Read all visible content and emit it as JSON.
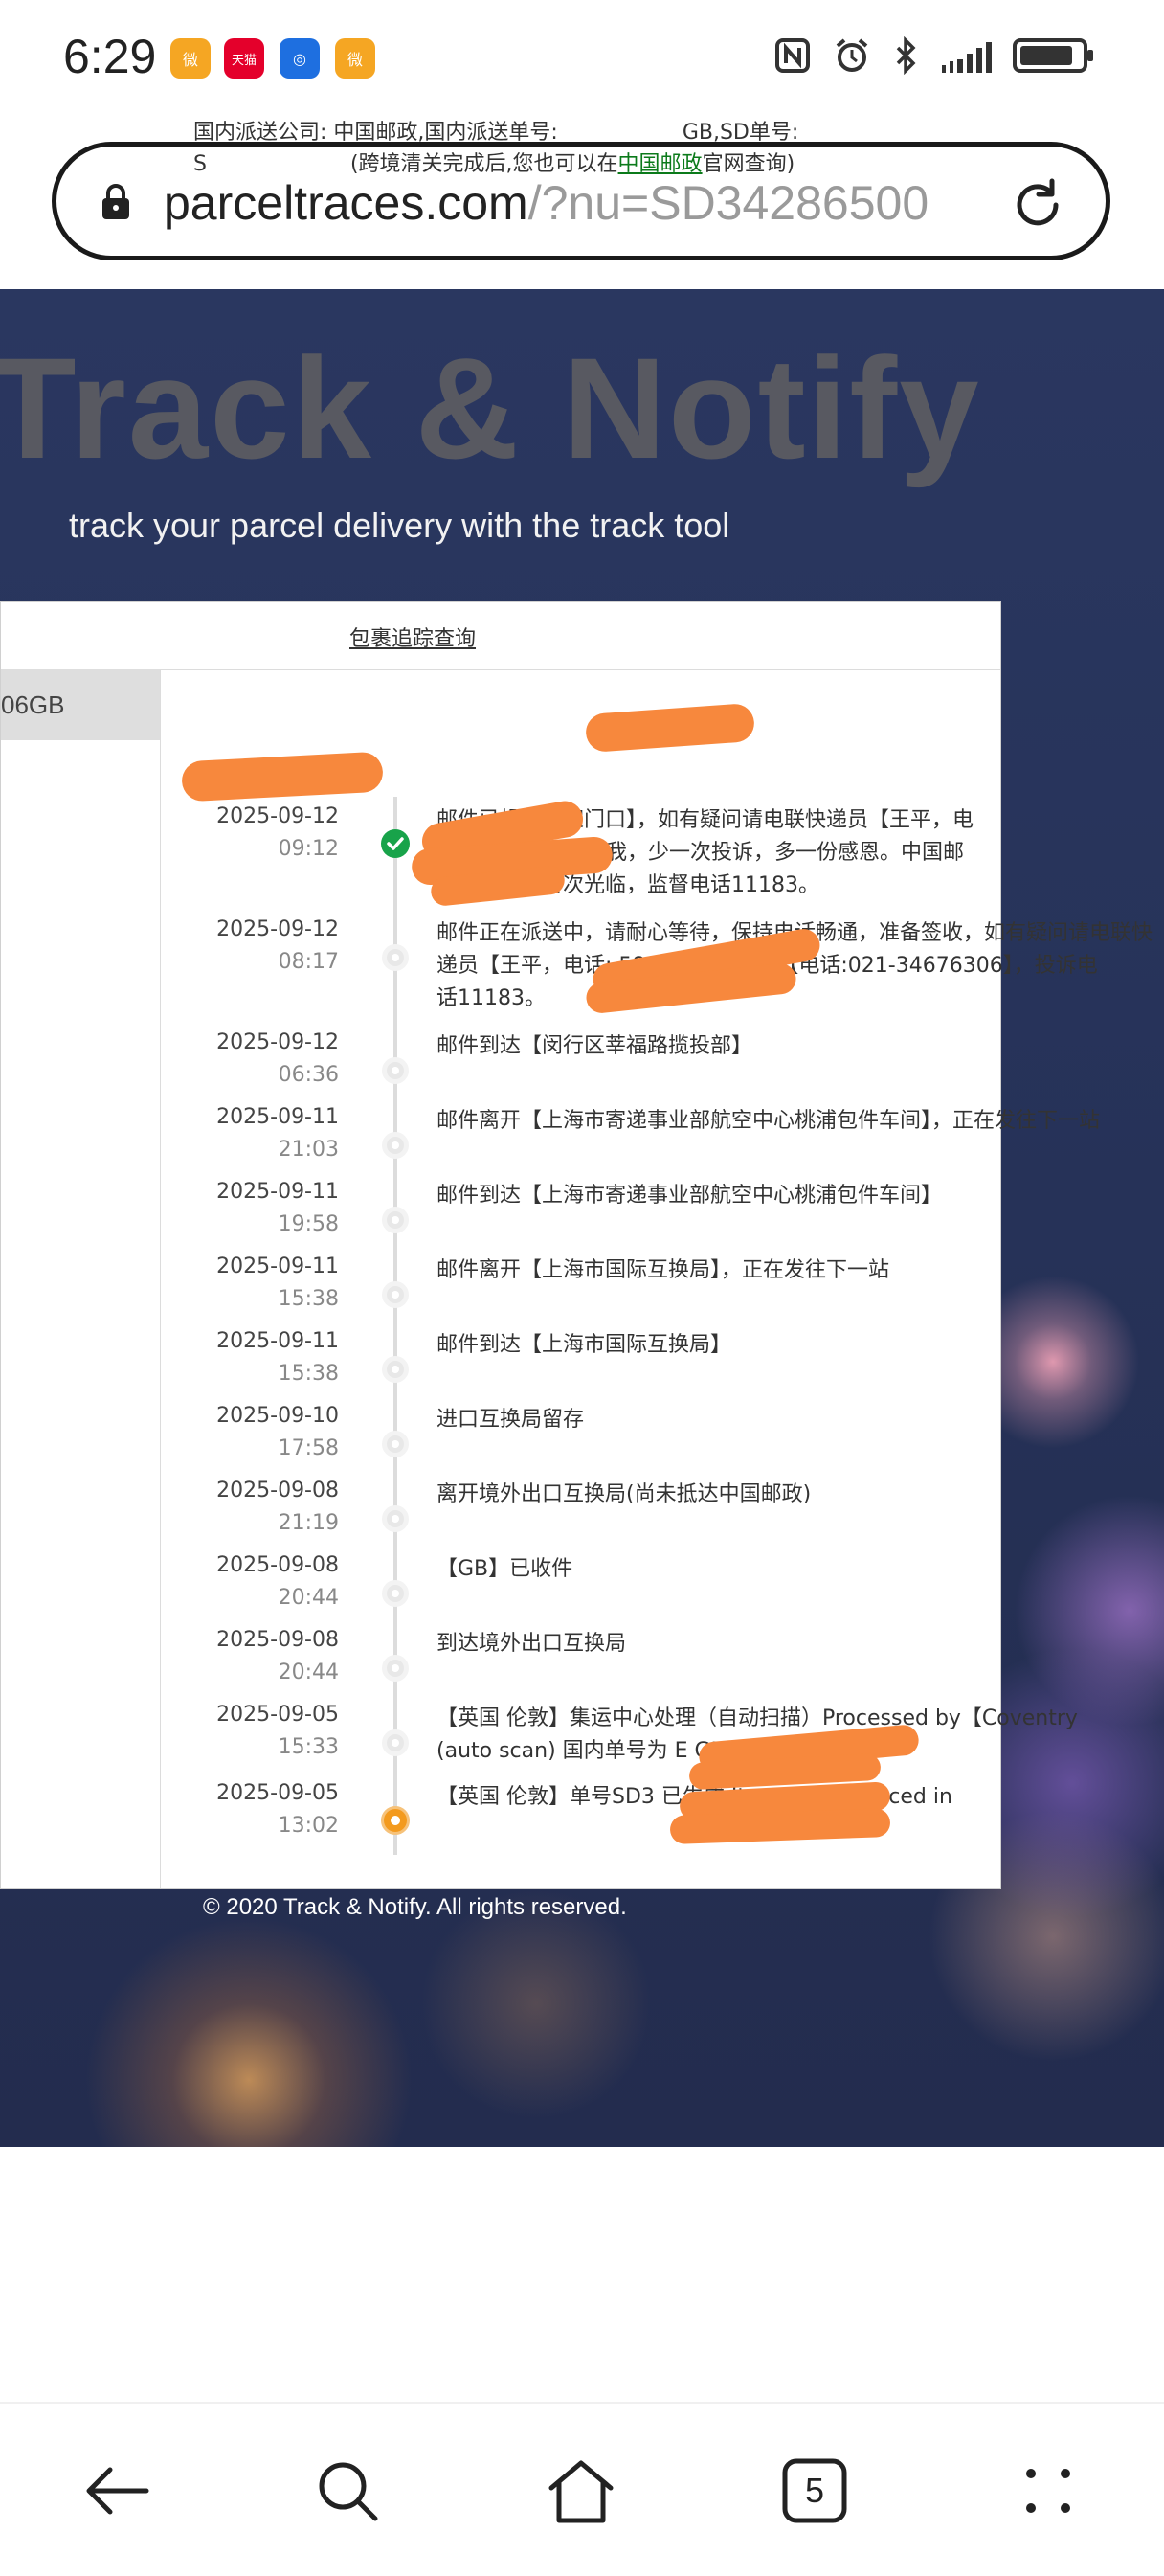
{
  "status_bar": {
    "time": "6:29",
    "notification_icons": [
      {
        "name": "weibo-icon",
        "color": "#f5a623",
        "glyph": "微"
      },
      {
        "name": "tmall-icon",
        "color": "#e4002b",
        "glyph": "天猫"
      },
      {
        "name": "lightbulb-app-icon",
        "color": "#1e6fe0",
        "glyph": "◎"
      },
      {
        "name": "weibo-icon-2",
        "color": "#f5a623",
        "glyph": "微"
      }
    ]
  },
  "browser": {
    "url_domain": "parceltraces.com",
    "url_path": "/?nu=SD34286500",
    "tab_count": "5"
  },
  "hero": {
    "title": "Track & Notify",
    "subtitle": "track your parcel delivery with the track tool"
  },
  "card": {
    "title": "包裹追踪查询",
    "tab_label": "06GB",
    "info_line1": "国内派送公司: 中国邮政,国内派送单号:",
    "info_line1_suffix": "GB,SD单号:",
    "info_line2_prefix": "S",
    "info_line2_mid": "(跨境清关完成后,您也可以在",
    "info_link": "中国邮政",
    "info_line2_end": "官网查询)"
  },
  "events": [
    {
      "date": "2025-09-12",
      "time": "09:12",
      "lines": [
        "邮件已投至【家门口】，如有疑问请电联快递员【王平，电",
        "1829】。有事呼叫我，少一次投诉，多一份感恩。中国邮",
        "政期待您的再次光临，监督电话11183。"
      ],
      "status": "delivered"
    },
    {
      "date": "2025-09-12",
      "time": "08:17",
      "lines": [
        "邮件正在派送中，请耐心等待，保持电话畅通，准备签收，如有疑问请电联快",
        "递员【王平，电话:       5829】或揽投部【电话:021-34676306】，投诉电",
        "话11183。"
      ],
      "status": "normal"
    },
    {
      "date": "2025-09-12",
      "time": "06:36",
      "lines": [
        "邮件到达【闵行区莘福路揽投部】"
      ],
      "status": "normal"
    },
    {
      "date": "2025-09-11",
      "time": "21:03",
      "lines": [
        "邮件离开【上海市寄递事业部航空中心桃浦包件车间】，正在发往下一站"
      ],
      "status": "normal"
    },
    {
      "date": "2025-09-11",
      "time": "19:58",
      "lines": [
        "邮件到达【上海市寄递事业部航空中心桃浦包件车间】"
      ],
      "status": "normal"
    },
    {
      "date": "2025-09-11",
      "time": "15:38",
      "lines": [
        "邮件离开【上海市国际互换局】，正在发往下一站"
      ],
      "status": "normal"
    },
    {
      "date": "2025-09-11",
      "time": "15:38",
      "lines": [
        "邮件到达【上海市国际互换局】"
      ],
      "status": "normal"
    },
    {
      "date": "2025-09-10",
      "time": "17:58",
      "lines": [
        "进口互换局留存"
      ],
      "status": "normal"
    },
    {
      "date": "2025-09-08",
      "time": "21:19",
      "lines": [
        "离开境外出口互换局(尚未抵达中国邮政)"
      ],
      "status": "normal"
    },
    {
      "date": "2025-09-08",
      "time": "20:44",
      "lines": [
        "【GB】已收件"
      ],
      "status": "normal"
    },
    {
      "date": "2025-09-08",
      "time": "20:44",
      "lines": [
        "到达境外出口互换局"
      ],
      "status": "normal"
    },
    {
      "date": "2025-09-05",
      "time": "15:33",
      "lines": [
        "【英国 伦敦】集运中心处理（自动扫描）Processed by【Coventry",
        "(auto scan) 国内单号为 E               GB"
      ],
      "status": "normal"
    },
    {
      "date": "2025-09-05",
      "time": "13:02",
      "lines": [
        "【英国 伦敦】单号SD3                    已生成 Item is announced in"
      ],
      "status": "origin"
    }
  ],
  "footer": {
    "copyright": "© 2020 Track & Notify. All rights reserved."
  }
}
